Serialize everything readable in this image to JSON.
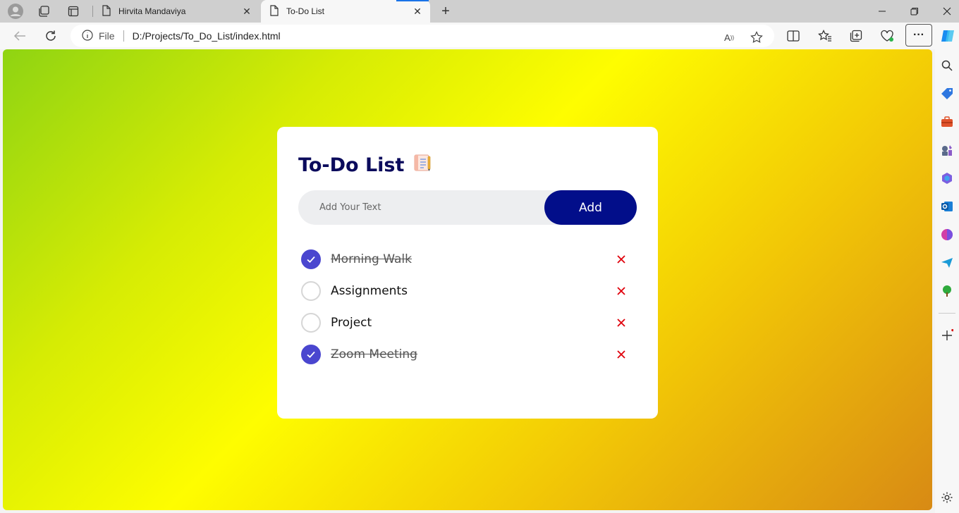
{
  "browser": {
    "tabs": [
      {
        "title": "Hirvita Mandaviya",
        "active": false
      },
      {
        "title": "To-Do List",
        "active": true
      }
    ],
    "address": {
      "security_label": "File",
      "url": "D:/Projects/To_Do_List/index.html"
    },
    "accent_color": "#1a73e8"
  },
  "app": {
    "title": "To-Do List",
    "title_emoji": "📑",
    "input": {
      "placeholder": "Add Your Text",
      "value": ""
    },
    "add_button_label": "Add",
    "colors": {
      "title": "#0b0b5c",
      "add_button": "#020e8a",
      "check_done": "#4a46cf",
      "delete": "#e0000b",
      "gradient": [
        "#8fd412",
        "#fefd00",
        "#d88a14"
      ]
    },
    "tasks": [
      {
        "text": "Morning Walk",
        "done": true
      },
      {
        "text": "Assignments",
        "done": false
      },
      {
        "text": "Project",
        "done": false
      },
      {
        "text": "Zoom Meeting",
        "done": true
      }
    ]
  }
}
